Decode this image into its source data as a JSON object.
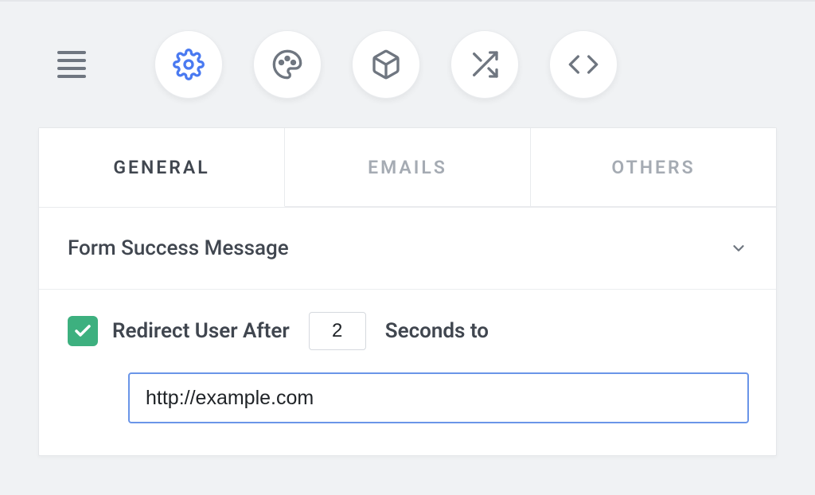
{
  "toolbar": {
    "buttons": [
      "settings",
      "appearance",
      "cube",
      "shuffle",
      "code"
    ],
    "active": "settings"
  },
  "tabs": [
    {
      "label": "GENERAL",
      "active": true
    },
    {
      "label": "EMAILS",
      "active": false
    },
    {
      "label": "OTHERS",
      "active": false
    }
  ],
  "section": {
    "title": "Form Success Message",
    "expanded": true
  },
  "redirect": {
    "checked": true,
    "label_before": "Redirect User After",
    "seconds": "2",
    "label_after": "Seconds to",
    "url": "http://example.com"
  }
}
